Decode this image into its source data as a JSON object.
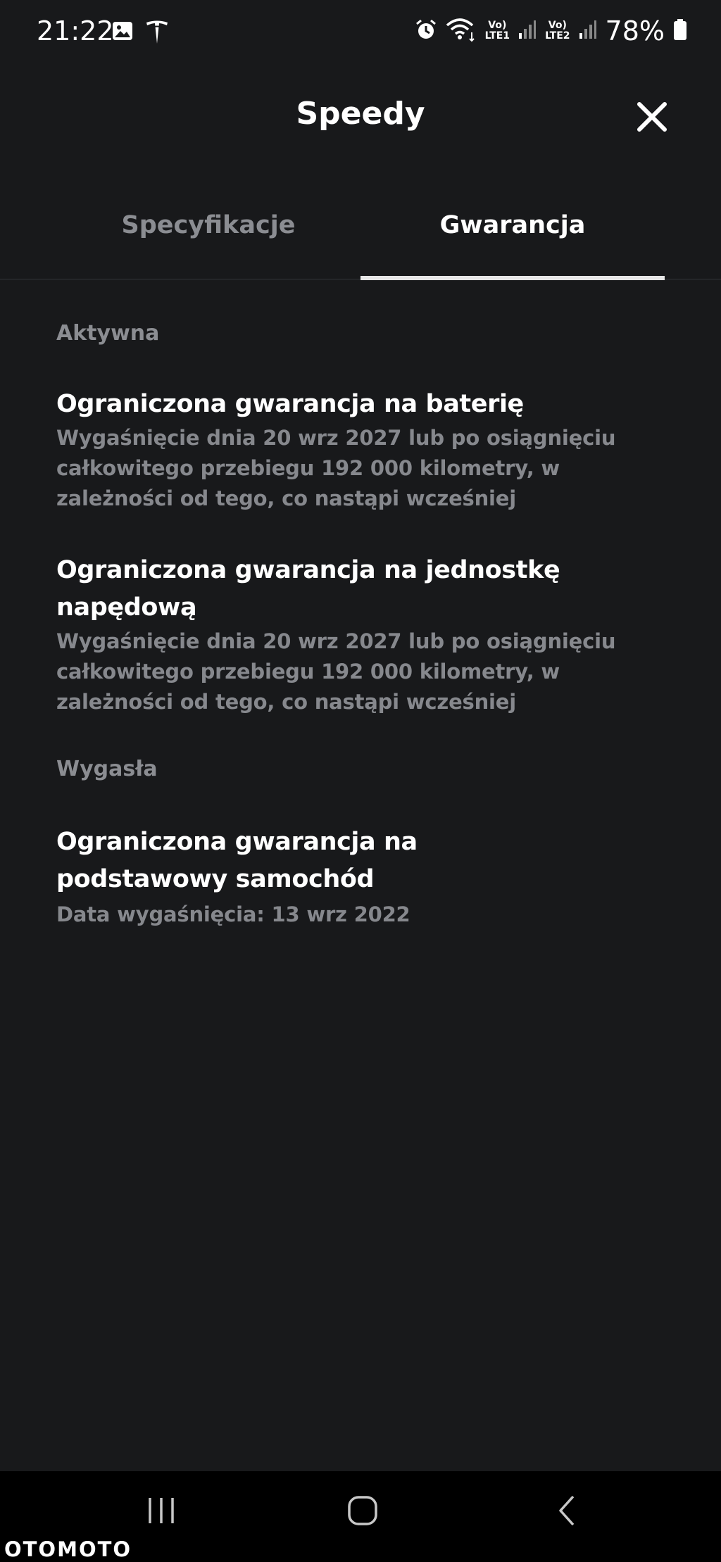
{
  "status_bar": {
    "time": "21:22",
    "battery_percent": "78%",
    "sim1_top": "Vo)",
    "sim1_bottom": "LTE1",
    "sim2_top": "Vo)",
    "sim2_bottom": "LTE2",
    "icons": [
      "gallery-icon",
      "tesla-logo-icon",
      "alarm-icon",
      "wifi-icon",
      "signal-icon",
      "battery-icon"
    ]
  },
  "header": {
    "title": "Speedy",
    "close_icon": "close-icon"
  },
  "tabs": [
    {
      "label": "Specyfikacje",
      "active": false
    },
    {
      "label": "Gwarancja",
      "active": true
    }
  ],
  "sections": {
    "active": {
      "label": "Aktywna",
      "items": [
        {
          "title": "Ograniczona gwarancja na baterię",
          "description": "Wygaśnięcie dnia 20 wrz 2027 lub po osiągnięciu całkowitego przebiegu 192 000 kilometry, w zależności od tego, co nastąpi wcześniej"
        },
        {
          "title": "Ograniczona gwarancja na jednostkę napędową",
          "description": "Wygaśnięcie dnia 20 wrz 2027 lub po osiągnięciu całkowitego przebiegu 192 000 kilometry, w zależności od tego, co nastąpi wcześniej"
        }
      ]
    },
    "expired": {
      "label": "Wygasła",
      "items": [
        {
          "title": "Ograniczona gwarancja na podstawowy samochód",
          "description": "Data wygaśnięcia: 13 wrz 2022"
        }
      ]
    }
  },
  "nav_bar": {
    "buttons": [
      "recent-apps-icon",
      "home-icon",
      "back-icon"
    ]
  },
  "watermark": "OTOMOTO",
  "colors": {
    "background": "#18191b",
    "text_primary": "#ffffff",
    "text_secondary": "#86888d",
    "tab_underline": "#e6e6e6",
    "nav_background": "#000000"
  }
}
